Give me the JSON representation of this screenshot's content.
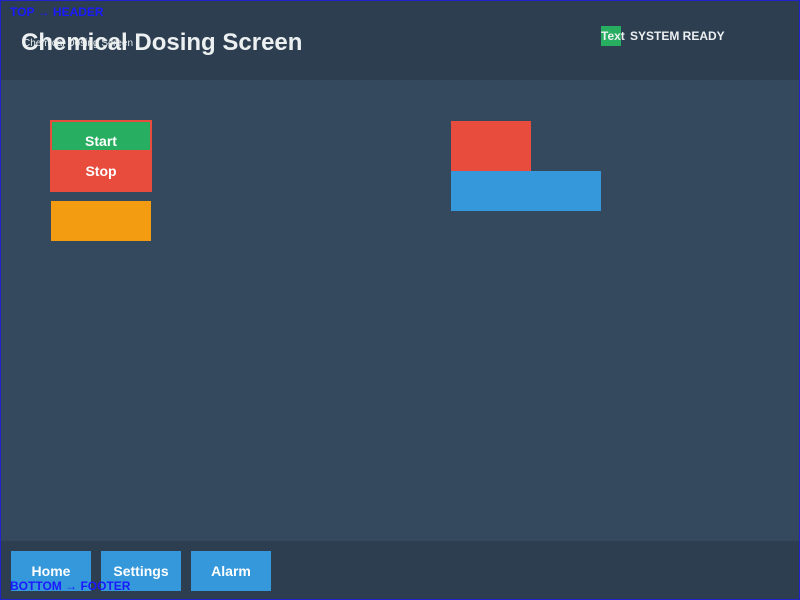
{
  "annotations": {
    "top": "TOP → HEADER",
    "bottom": "BOTTOM → FOOTER"
  },
  "header": {
    "title": "Chemical Dosing Screen",
    "title_overlay": "Chemical Dosing Screen",
    "status_indicator_text": "Text",
    "status_label": "SYSTEM READY"
  },
  "controls": {
    "start_label": "Start",
    "stop_label": "Stop",
    "orange_label": ""
  },
  "footer": {
    "nav": [
      {
        "label": "Home"
      },
      {
        "label": "Settings"
      },
      {
        "label": "Alarm"
      }
    ]
  },
  "colors": {
    "background": "#34495e",
    "header_footer": "#2c3e50",
    "green": "#27ae60",
    "red": "#e74c3c",
    "orange": "#f39c12",
    "blue": "#3498db",
    "text": "#ecf0f1",
    "annotation": "#1a1aff"
  }
}
